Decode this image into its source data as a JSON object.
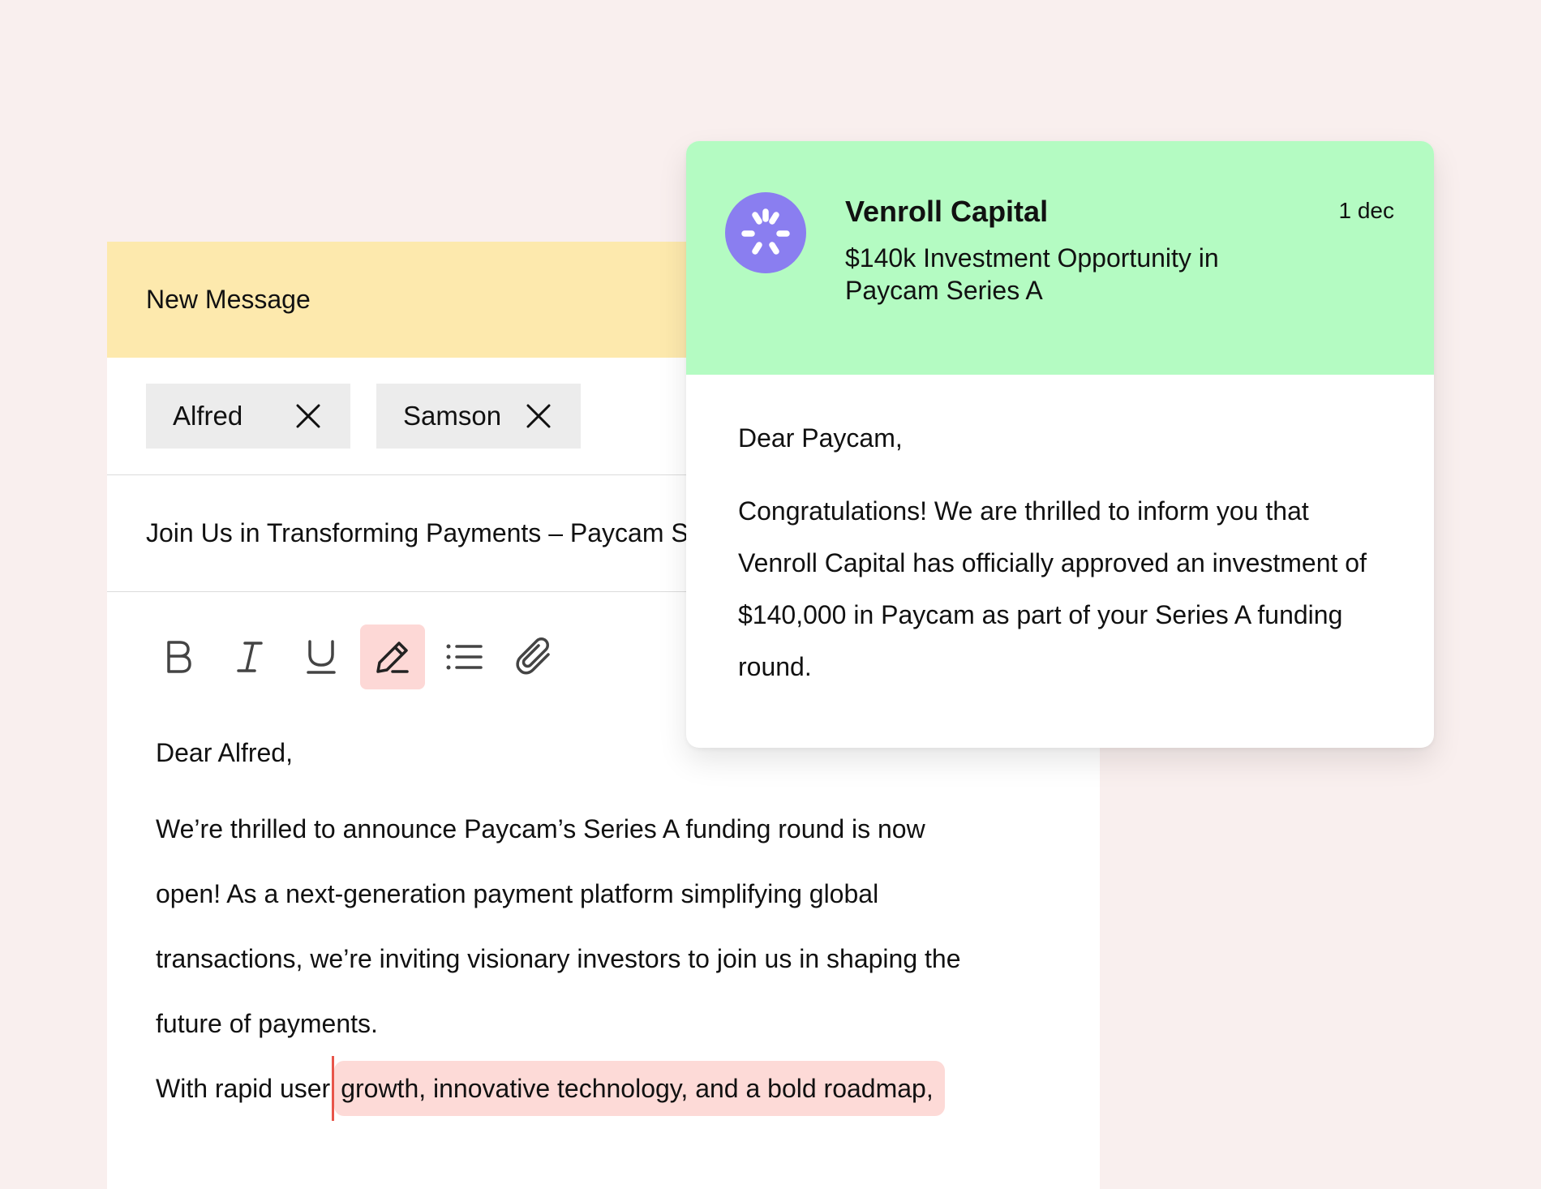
{
  "compose": {
    "title": "New Message",
    "recipients": [
      {
        "name": "Alfred"
      },
      {
        "name": "Samson"
      }
    ],
    "subject": "Join Us in Transforming Payments – Paycam Series A",
    "toolbar": {
      "bold_icon": "bold-icon",
      "italic_icon": "italic-icon",
      "underline_icon": "underline-icon",
      "highlight_icon": "pen-icon",
      "list_icon": "bullet-list-icon",
      "attach_icon": "paperclip-icon",
      "active_tool": "highlight",
      "active_color": "#fdd8d6"
    },
    "body": {
      "greeting": "Dear Alfred,",
      "lines": [
        "We’re thrilled to announce Paycam’s Series A funding round is now",
        "open! As a next-generation payment platform simplifying global",
        "transactions, we’re inviting visionary investors to join us in shaping the",
        "future of payments."
      ],
      "last_line_prefix": "With rapid user",
      "last_line_selected": "growth, innovative technology, and a bold roadmap,"
    }
  },
  "notification": {
    "sender": "Venroll Capital",
    "date": "1 dec",
    "subject": "$140k Investment Opportunity in Paycam Series A",
    "greeting": "Dear Paycam,",
    "body": "Congratulations! We are thrilled to inform you that Venroll Capital has officially approved an investment of $140,000 in Paycam as part of your Series A funding round.",
    "header_color": "#b4fbc2",
    "avatar_color": "#8a7ef0"
  },
  "colors": {
    "background": "#f9efee",
    "compose_header": "#fde9ad",
    "selection": "#fddad7",
    "caret": "#e8554a"
  }
}
